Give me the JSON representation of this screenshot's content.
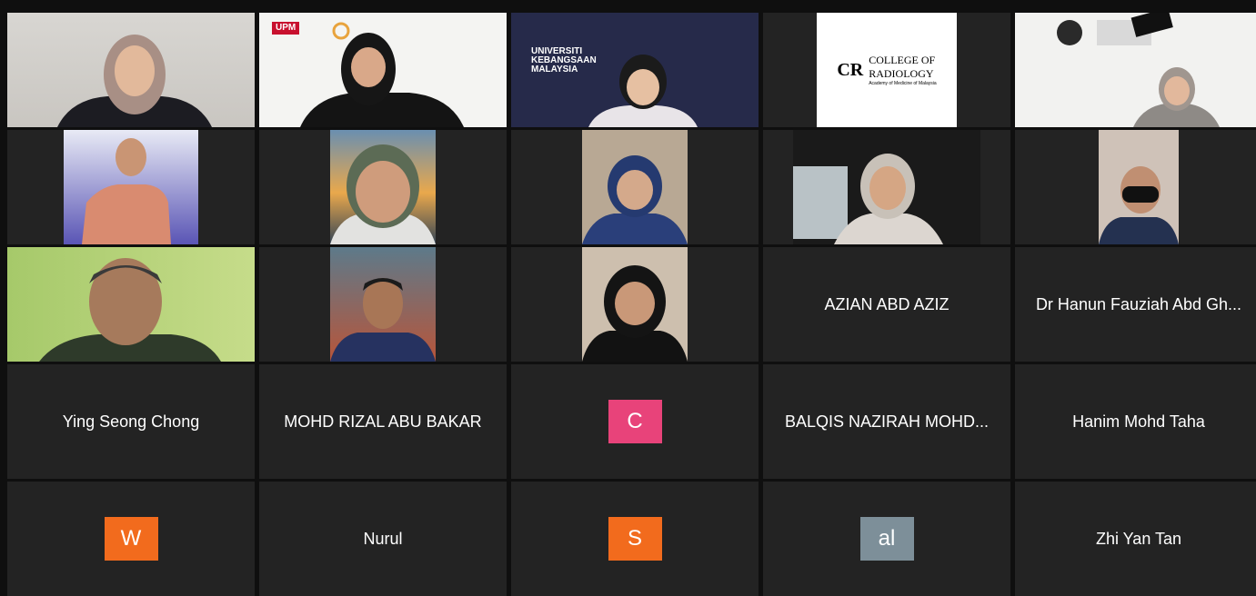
{
  "meeting": {
    "participants": {
      "azian": "AZIAN ABD AZIZ",
      "hanun": "Dr Hanun Fauziah Abd Gh...",
      "ying": "Ying Seong Chong",
      "rizal": "MOHD RIZAL ABU BAKAR",
      "balqis": "BALQIS NAZIRAH MOHD...",
      "hanim": "Hanim Mohd Taha",
      "nurul": "Nurul",
      "zhi": "Zhi Yan Tan"
    },
    "avatars": [
      {
        "initial": "C",
        "color": "#e8437a"
      },
      {
        "initial": "W",
        "color": "#f26b1d"
      },
      {
        "initial": "S",
        "color": "#f26b1d"
      },
      {
        "initial": "al",
        "color": "#7d8f99"
      }
    ],
    "backgrounds": {
      "upm": "UPM",
      "ukm": "UNIVERSITI KEBANGSAAN MALAYSIA",
      "radiology_title1": "COLLEGE OF",
      "radiology_title2": "RADIOLOGY",
      "radiology_sub": "Academy of Medicine of Malaysia",
      "radiology_mark": "CR"
    },
    "colors": {
      "tile_bg": "#232323",
      "active_speaker": "#23d959"
    }
  }
}
